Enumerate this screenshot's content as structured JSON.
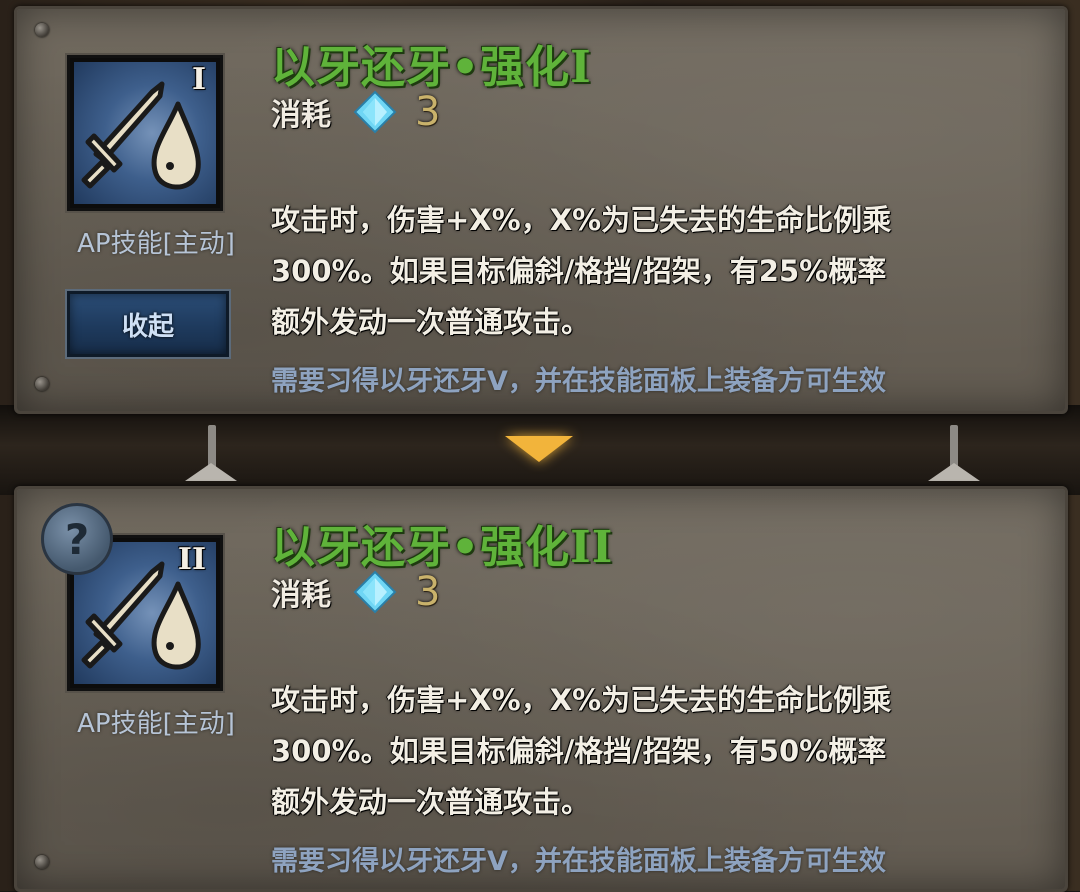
{
  "cards": [
    {
      "title": "以牙还牙•强化",
      "title_roman": "I",
      "icon_roman": "I",
      "icon": "sword-drop-icon",
      "cost_label": "消耗",
      "cost_value": "3",
      "type_label": "AP技能[主动]",
      "collapse_label": "收起",
      "description": [
        "攻击时，伤害+X%，X%为已失去的生命比例乘",
        "300%。如果目标偏斜/格挡/招架，有25%概率",
        "额外发动一次普通攻击。"
      ],
      "requirement": "需要习得以牙还牙V，并在技能面板上装备方可生效"
    },
    {
      "title": "以牙还牙•强化",
      "title_roman": "II",
      "icon_roman": "II",
      "icon": "sword-drop-icon",
      "help_icon": "question-mark-icon",
      "help_symbol": "?",
      "cost_label": "消耗",
      "cost_value": "3",
      "type_label": "AP技能[主动]",
      "description": [
        "攻击时，伤害+X%，X%为已失去的生命比例乘",
        "300%。如果目标偏斜/格挡/招架，有50%概率",
        "额外发动一次普通攻击。"
      ],
      "requirement": "需要习得以牙还牙V，并在技能面板上装备方可生效"
    }
  ],
  "colors": {
    "title_green": "#5fb33a",
    "requirement_blue": "#8ea3c0",
    "arrow_gold": "#f2b43b"
  }
}
